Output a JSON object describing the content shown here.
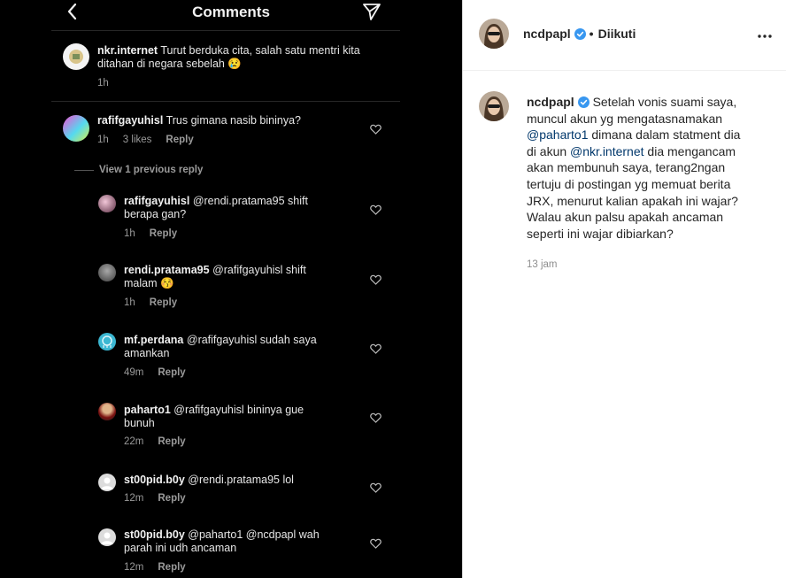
{
  "left": {
    "title": "Comments",
    "comments": [
      {
        "user": "nkr.internet",
        "lines": [
          "Turut berduka cita, salah satu mentri kita",
          "ditahan di negara sebelah 😢"
        ],
        "time": "1h"
      },
      {
        "user": "rafifgayuhisl",
        "lines": [
          "Trus gimana nasib bininya?"
        ],
        "time": "1h",
        "likes": "3 likes",
        "reply": "Reply"
      }
    ],
    "view_previous": "View 1 previous reply",
    "replies": [
      {
        "user": "rafifgayuhisl",
        "lines": [
          "@rendi.pratama95 shift",
          "berapa gan?"
        ],
        "time": "1h",
        "reply": "Reply"
      },
      {
        "user": "rendi.pratama95",
        "lines": [
          "@rafifgayuhisl shift",
          "malam 😚"
        ],
        "time": "1h",
        "reply": "Reply"
      },
      {
        "user": "mf.perdana",
        "lines": [
          "@rafifgayuhisl sudah saya",
          "amankan"
        ],
        "time": "49m",
        "reply": "Reply"
      },
      {
        "user": "paharto1",
        "lines": [
          "@rafifgayuhisl bininya gue",
          "bunuh"
        ],
        "time": "22m",
        "reply": "Reply"
      },
      {
        "user": "st00pid.b0y",
        "lines": [
          "@rendi.pratama95 lol"
        ],
        "time": "12m",
        "reply": "Reply"
      },
      {
        "user": "st00pid.b0y",
        "lines": [
          "@paharto1 @ncdpapl wah",
          "parah ini udh ancaman"
        ],
        "time": "12m",
        "reply": "Reply"
      }
    ]
  },
  "right": {
    "username": "ncdpapl",
    "follow": "Diikuti",
    "caption_lines": [
      "Setelah vonis suami saya,",
      "muncul akun yg mengatasnamakan",
      "@paharto1 dimana dalam statment dia",
      "di akun @nkr.internet dia mengancam",
      "akan membunuh saya, terang2ngan",
      "tertuju di postingan yg memuat berita",
      "JRX, menurut kalian apakah ini wajar?",
      "Walau akun palsu apakah ancaman",
      "seperti ini wajar dibiarkan?"
    ],
    "mention1": "@paharto1",
    "mention2": "@nkr.internet",
    "time": "13 jam"
  },
  "icons": {
    "back": "chevron-left-icon",
    "send": "send-icon",
    "heart": "heart-outline-icon",
    "verified": "verified-badge-icon",
    "more": "more-horizontal-icon"
  },
  "colors": {
    "left_bg": "#000000",
    "mention": "#00376b",
    "verified": "#3897f0"
  }
}
